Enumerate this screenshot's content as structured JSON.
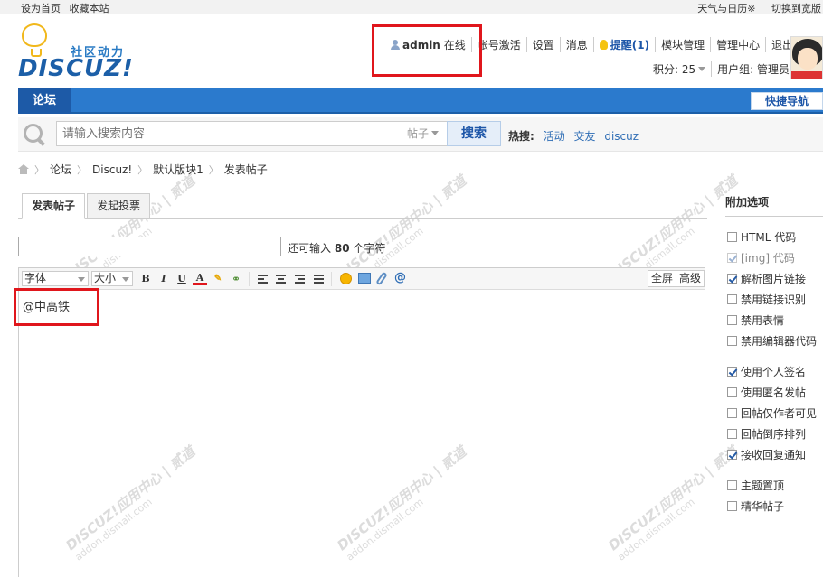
{
  "topbar": {
    "set_home": "设为首页",
    "bookmark": "收藏本站",
    "weather": "天气与日历※",
    "switch_width": "切换到宽版"
  },
  "logo": {
    "tagline": "社区动力",
    "wordmark": "DISCUZ!"
  },
  "user_nav": {
    "username": "admin",
    "status": "在线",
    "activate": "帐号激活",
    "settings": "设置",
    "messages": "消息",
    "remind": "提醒(1)",
    "module_manage": "模块管理",
    "admin_center": "管理中心",
    "logout": "退出",
    "points_label": "积分: 25",
    "usergroup": "用户组: 管理员"
  },
  "nav": {
    "forum_tab": "论坛",
    "quick_nav": "快捷导航"
  },
  "search": {
    "placeholder": "请输入搜索内容",
    "type": "帖子",
    "button": "搜索",
    "hot_label": "热搜:",
    "hot_terms": [
      "活动",
      "交友",
      "discuz"
    ]
  },
  "breadcrumb": [
    "论坛",
    "Discuz!",
    "默认版块1",
    "发表帖子"
  ],
  "post_tabs": {
    "post_thread": "发表帖子",
    "poll": "发起投票"
  },
  "title_counter": {
    "prefix": "还可输入",
    "count": "80",
    "suffix": "个字符"
  },
  "editor": {
    "font_select": "字体",
    "size_select": "大小",
    "bold": "B",
    "italic": "I",
    "underline": "U",
    "font_color": "A",
    "fullscreen": "全屏",
    "advanced": "高级",
    "content": "@中高铁"
  },
  "options": {
    "title": "附加选项",
    "items": [
      {
        "label": "HTML 代码",
        "checked": false
      },
      {
        "label": "[img] 代码",
        "checked": true
      },
      {
        "label": "解析图片链接",
        "checked": true
      },
      {
        "label": "禁用链接识别",
        "checked": false
      },
      {
        "label": "禁用表情",
        "checked": false
      },
      {
        "label": "禁用编辑器代码",
        "checked": false
      },
      {
        "label": "使用个人签名",
        "checked": true
      },
      {
        "label": "使用匿名发帖",
        "checked": false
      },
      {
        "label": "回帖仅作者可见",
        "checked": false
      },
      {
        "label": "回帖倒序排列",
        "checked": false
      },
      {
        "label": "接收回复通知",
        "checked": true
      },
      {
        "label": "主题置顶",
        "checked": false
      },
      {
        "label": "精华帖子",
        "checked": false
      }
    ]
  },
  "watermark": {
    "main": "DISCUZ!应用中心 | 贰道",
    "sub": "addon.dismall.com"
  },
  "colors": {
    "nav_blue": "#2b7acd",
    "highlight_red": "#e0161c",
    "link_blue": "#2e6db5"
  }
}
